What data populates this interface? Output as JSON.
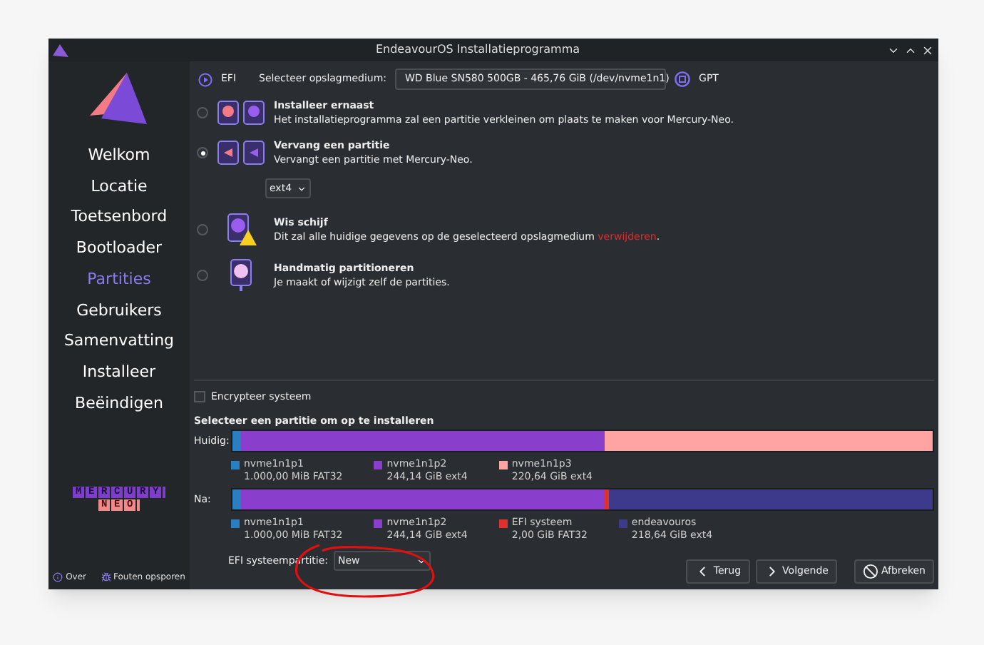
{
  "window": {
    "title": "EndeavourOS Installatieprogramma"
  },
  "sidebar": {
    "logo": [
      "MERCURY",
      "NEO"
    ],
    "items": [
      {
        "label": "Welkom",
        "selected": false
      },
      {
        "label": "Locatie",
        "selected": false
      },
      {
        "label": "Toetsenbord",
        "selected": false
      },
      {
        "label": "Bootloader",
        "selected": false
      },
      {
        "label": "Partities",
        "selected": true
      },
      {
        "label": "Gebruikers",
        "selected": false
      },
      {
        "label": "Samenvatting",
        "selected": false
      },
      {
        "label": "Installeer",
        "selected": false
      },
      {
        "label": "Beëindigen",
        "selected": false
      }
    ],
    "footer": [
      {
        "kind": "about",
        "label": "Over"
      },
      {
        "kind": "debug",
        "label": "Fouten opsporen"
      }
    ]
  },
  "top_bar": {
    "boot": "EFI",
    "storage_label": "Selecteer opslagmedium:",
    "storage": "WD Blue SN580 500GB - 465,76 GiB (/dev/nvme1n1)",
    "table": "GPT"
  },
  "options": [
    {
      "kind": "alongside",
      "title": "Installeer ernaast",
      "description": "Het installatieprogramma zal een partitie verkleinen om plaats te maken voor Mercury-Neo.",
      "selected": false
    },
    {
      "kind": "replace",
      "title": "Vervang een partitie",
      "description": "Vervangt een partitie met Mercury-Neo.",
      "selected": true,
      "filesystem": "ext4"
    },
    {
      "kind": "erase",
      "title": "Wis schijf",
      "description": "Dit zal alle huidige gegevens op de geselecteerd opslagmedium ",
      "warning": "verwijderen",
      "end": ".",
      "selected": false
    },
    {
      "kind": "manual",
      "title": "Handmatig partitioneren",
      "description": "Je maakt of wijzigt zelf de partities.",
      "selected": false
    }
  ],
  "encrypt": {
    "label": "Encrypteer systeem",
    "checked": false
  },
  "heading": "Selecteer een partitie om op te installeren",
  "bars": [
    {
      "label": "Huidig:",
      "partitions": [
        {
          "name": "nvme1n1p1",
          "info": "1.000,00 MiB FAT32",
          "color": "#2a7fc0"
        },
        {
          "name": "nvme1n1p2",
          "info": "244,14 GiB ext4",
          "color": "#8a3fcc"
        },
        {
          "name": "nvme1n1p3",
          "info": "220,64 GiB ext4",
          "color": "#ffa3a3"
        }
      ]
    },
    {
      "label": "Na:",
      "partitions": [
        {
          "name": "nvme1n1p1",
          "info": "1.000,00 MiB FAT32",
          "color": "#2a7fc0"
        },
        {
          "name": "nvme1n1p2",
          "info": "244,14 GiB ext4",
          "color": "#8a3fcc"
        },
        {
          "name": "EFI systeem",
          "info": "2,00 GiB FAT32",
          "color": "#e0302e"
        },
        {
          "name": "endeavouros",
          "info": "218,64 GiB ext4",
          "color": "#3d3a8c"
        }
      ]
    }
  ],
  "efi": {
    "label": "EFI systeempartitie:",
    "value": "New"
  },
  "buttons": [
    {
      "kind": "back",
      "label": "Terug"
    },
    {
      "kind": "next",
      "label": "Volgende"
    },
    {
      "kind": "cancel",
      "label": "Afbreken"
    }
  ]
}
